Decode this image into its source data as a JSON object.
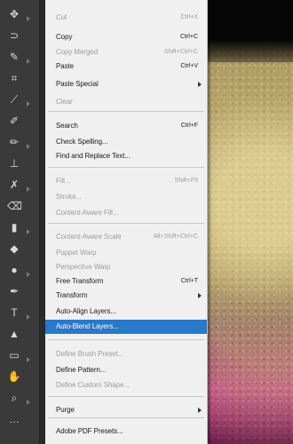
{
  "colors": {
    "menu_bg": "#f0f0f0",
    "highlight": "#2a78c8",
    "disabled_text": "#9d9d9d",
    "toolbar_bg": "#3a3a3a"
  },
  "toolbar": {
    "tools": [
      {
        "name": "move-tool-icon",
        "glyph": "✥"
      },
      {
        "name": "lasso-tool-icon",
        "glyph": "⊃"
      },
      {
        "name": "quick-select-tool-icon",
        "glyph": "✎"
      },
      {
        "name": "crop-tool-icon",
        "glyph": "⌗"
      },
      {
        "name": "eyedropper-tool-icon",
        "glyph": "⟋"
      },
      {
        "name": "healing-brush-tool-icon",
        "glyph": "✐"
      },
      {
        "name": "brush-tool-icon",
        "glyph": "✏"
      },
      {
        "name": "clone-stamp-tool-icon",
        "glyph": "⊥"
      },
      {
        "name": "history-brush-tool-icon",
        "glyph": "✗"
      },
      {
        "name": "eraser-tool-icon",
        "glyph": "⌫"
      },
      {
        "name": "gradient-tool-icon",
        "glyph": "▮"
      },
      {
        "name": "blur-tool-icon",
        "glyph": "◆"
      },
      {
        "name": "dodge-tool-icon",
        "glyph": "●"
      },
      {
        "name": "pen-tool-icon",
        "glyph": "✒"
      },
      {
        "name": "type-tool-icon",
        "glyph": "T"
      },
      {
        "name": "path-select-tool-icon",
        "glyph": "▲"
      },
      {
        "name": "shape-tool-icon",
        "glyph": "▭"
      },
      {
        "name": "hand-tool-icon",
        "glyph": "✋"
      },
      {
        "name": "zoom-tool-icon",
        "glyph": "⌕"
      },
      {
        "name": "more-tools-icon",
        "glyph": "…"
      }
    ]
  },
  "menu": {
    "items": [
      {
        "label": "Cut",
        "shortcut": "Ctrl+X",
        "disabled": true
      },
      {
        "label": "Copy",
        "shortcut": "Ctrl+C"
      },
      {
        "label": "Copy Merged",
        "shortcut": "Shift+Ctrl+C",
        "disabled": true
      },
      {
        "label": "Paste",
        "shortcut": "Ctrl+V"
      },
      {
        "label": "Paste Special",
        "submenu": true
      },
      {
        "label": "Clear",
        "disabled": true
      },
      {
        "label": "Search",
        "shortcut": "Ctrl+F"
      },
      {
        "label": "Check Spelling..."
      },
      {
        "label": "Find and Replace Text..."
      },
      {
        "label": "Fill...",
        "shortcut": "Shift+F5",
        "disabled": true
      },
      {
        "label": "Stroke...",
        "disabled": true
      },
      {
        "label": "Content-Aware Fill...",
        "disabled": true
      },
      {
        "label": "Content-Aware Scale",
        "shortcut": "Alt+Shift+Ctrl+C",
        "disabled": true
      },
      {
        "label": "Puppet Warp",
        "disabled": true
      },
      {
        "label": "Perspective Warp",
        "disabled": true
      },
      {
        "label": "Free Transform",
        "shortcut": "Ctrl+T"
      },
      {
        "label": "Transform",
        "submenu": true
      },
      {
        "label": "Auto-Align Layers..."
      },
      {
        "label": "Auto-Blend Layers...",
        "highlight": true
      },
      {
        "label": "Define Brush Preset...",
        "disabled": true
      },
      {
        "label": "Define Pattern..."
      },
      {
        "label": "Define Custom Shape...",
        "disabled": true
      },
      {
        "label": "Purge",
        "submenu": true
      },
      {
        "label": "Adobe PDF Presets..."
      }
    ]
  }
}
